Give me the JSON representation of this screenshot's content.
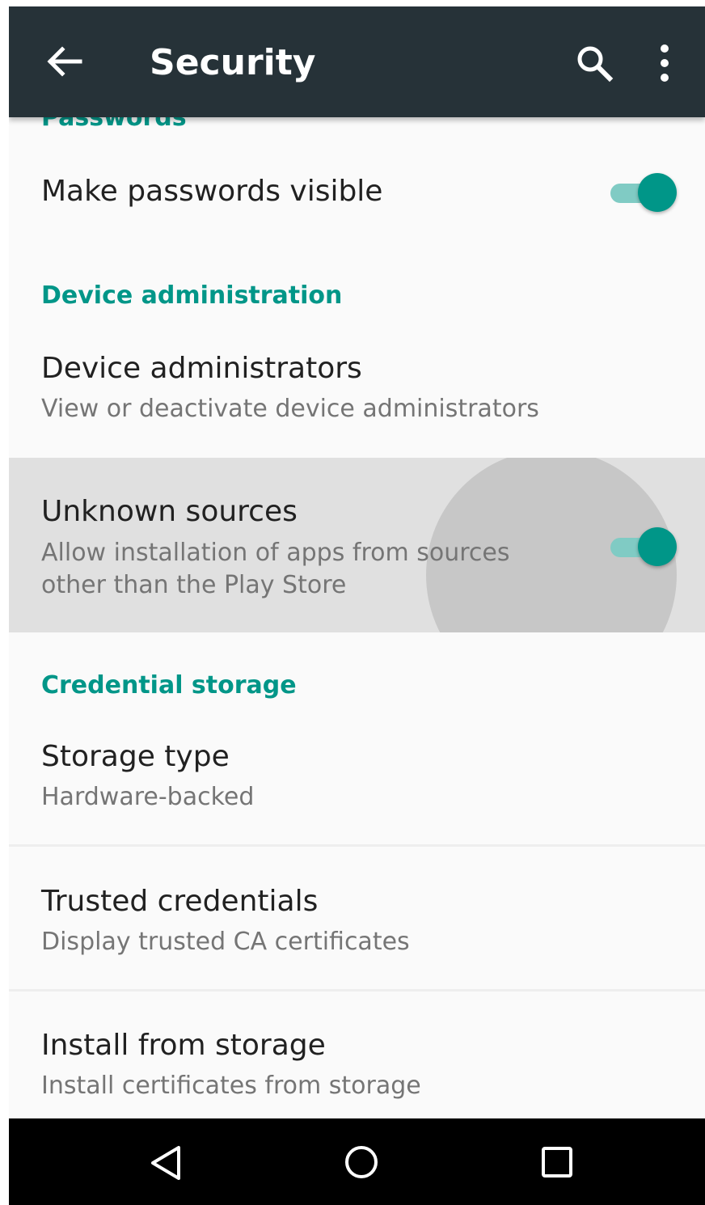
{
  "appbar": {
    "title": "Security",
    "back_icon": "arrow-back-icon",
    "search_icon": "search-icon",
    "more_icon": "more-vert-icon"
  },
  "sections": {
    "passwords_header": "Passwords",
    "device_admin_header": "Device administration",
    "credential_storage_header": "Credential storage"
  },
  "items": {
    "make_passwords_visible": {
      "title": "Make passwords visible",
      "checked": true
    },
    "device_administrators": {
      "title": "Device administrators",
      "subtitle": "View or deactivate device administrators"
    },
    "unknown_sources": {
      "title": "Unknown sources",
      "subtitle": "Allow installation of apps from sources other than the Play Store",
      "checked": true
    },
    "storage_type": {
      "title": "Storage type",
      "subtitle": "Hardware-backed"
    },
    "trusted_credentials": {
      "title": "Trusted credentials",
      "subtitle": "Display trusted CA certificates"
    },
    "install_from_storage": {
      "title": "Install from storage",
      "subtitle": "Install certificates from storage"
    }
  },
  "navbar": {
    "back_icon": "nav-back-icon",
    "home_icon": "nav-home-icon",
    "recents_icon": "nav-recents-icon"
  },
  "colors": {
    "appbar": "#263238",
    "accent": "#009688",
    "switch_track": "#80cbc4",
    "pressed_row": "#e0e0e0"
  }
}
